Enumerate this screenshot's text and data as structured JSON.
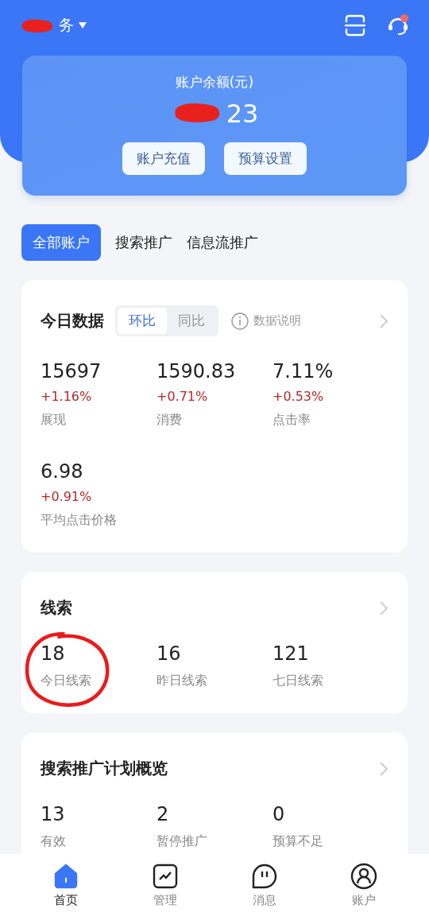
{
  "header": {
    "account_name": "务",
    "redacted": true
  },
  "balance": {
    "label": "账户余额(元)",
    "value": "23",
    "redacted": true,
    "buttons": [
      "账户充值",
      "预算设置"
    ]
  },
  "tabs": [
    {
      "label": "全部账户",
      "selected": true
    },
    {
      "label": "搜索推广",
      "selected": false
    },
    {
      "label": "信息流推广",
      "selected": false
    }
  ],
  "today": {
    "title": "今日数据",
    "toggle": [
      {
        "label": "环比",
        "selected": true
      },
      {
        "label": "同比",
        "selected": false
      }
    ],
    "info": "数据说明",
    "metrics": [
      {
        "value": "15697",
        "change": "+1.16%",
        "label": "展现"
      },
      {
        "value": "1590.83",
        "change": "+0.71%",
        "label": "消费"
      },
      {
        "value": "7.11%",
        "change": "+0.53%",
        "label": "点击率"
      },
      {
        "value": "6.98",
        "change": "+0.91%",
        "label": "平均点击价格"
      }
    ]
  },
  "leads": {
    "title": "线索",
    "metrics": [
      {
        "value": "18",
        "label": "今日线索",
        "circled": true
      },
      {
        "value": "16",
        "label": "昨日线索",
        "circled": false
      },
      {
        "value": "121",
        "label": "七日线索",
        "circled": false
      }
    ]
  },
  "plans": {
    "title": "搜索推广计划概览",
    "metrics": [
      {
        "value": "13",
        "label": "有效"
      },
      {
        "value": "2",
        "label": "暂停推广"
      },
      {
        "value": "0",
        "label": "预算不足"
      }
    ]
  },
  "nav": [
    {
      "label": "首页",
      "kind": "home",
      "selected": true
    },
    {
      "label": "管理",
      "kind": "chart",
      "selected": false
    },
    {
      "label": "消息",
      "kind": "chat",
      "selected": false
    },
    {
      "label": "账户",
      "kind": "user",
      "selected": false
    }
  ]
}
